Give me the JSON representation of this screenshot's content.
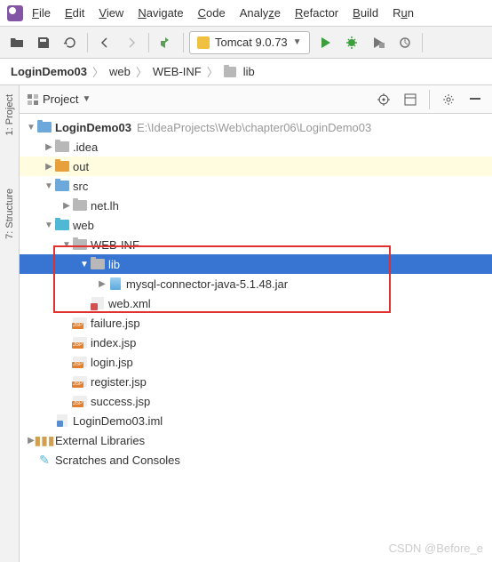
{
  "menu": {
    "file": "File",
    "edit": "Edit",
    "view": "View",
    "navigate": "Navigate",
    "code": "Code",
    "analyze": "Analyze",
    "refactor": "Refactor",
    "build": "Build",
    "run": "Run"
  },
  "runConfig": "Tomcat 9.0.73",
  "breadcrumb": {
    "root": "LoginDemo03",
    "p1": "web",
    "p2": "WEB-INF",
    "p3": "lib"
  },
  "panel": {
    "title": "Project"
  },
  "vtabs": {
    "project": "1: Project",
    "structure": "7: Structure"
  },
  "tree": {
    "root": {
      "name": "LoginDemo03",
      "path": "E:\\IdeaProjects\\Web\\chapter06\\LoginDemo03"
    },
    "idea": ".idea",
    "out": "out",
    "src": "src",
    "netlh": "net.lh",
    "web": "web",
    "webinf": "WEB-INF",
    "lib": "lib",
    "jar": "mysql-connector-java-5.1.48.jar",
    "webxml": "web.xml",
    "failure": "failure.jsp",
    "index": "index.jsp",
    "login": "login.jsp",
    "register": "register.jsp",
    "success": "success.jsp",
    "iml": "LoginDemo03.iml",
    "extlib": "External Libraries",
    "scratches": "Scratches and Consoles"
  },
  "watermark": "CSDN @Before_e"
}
